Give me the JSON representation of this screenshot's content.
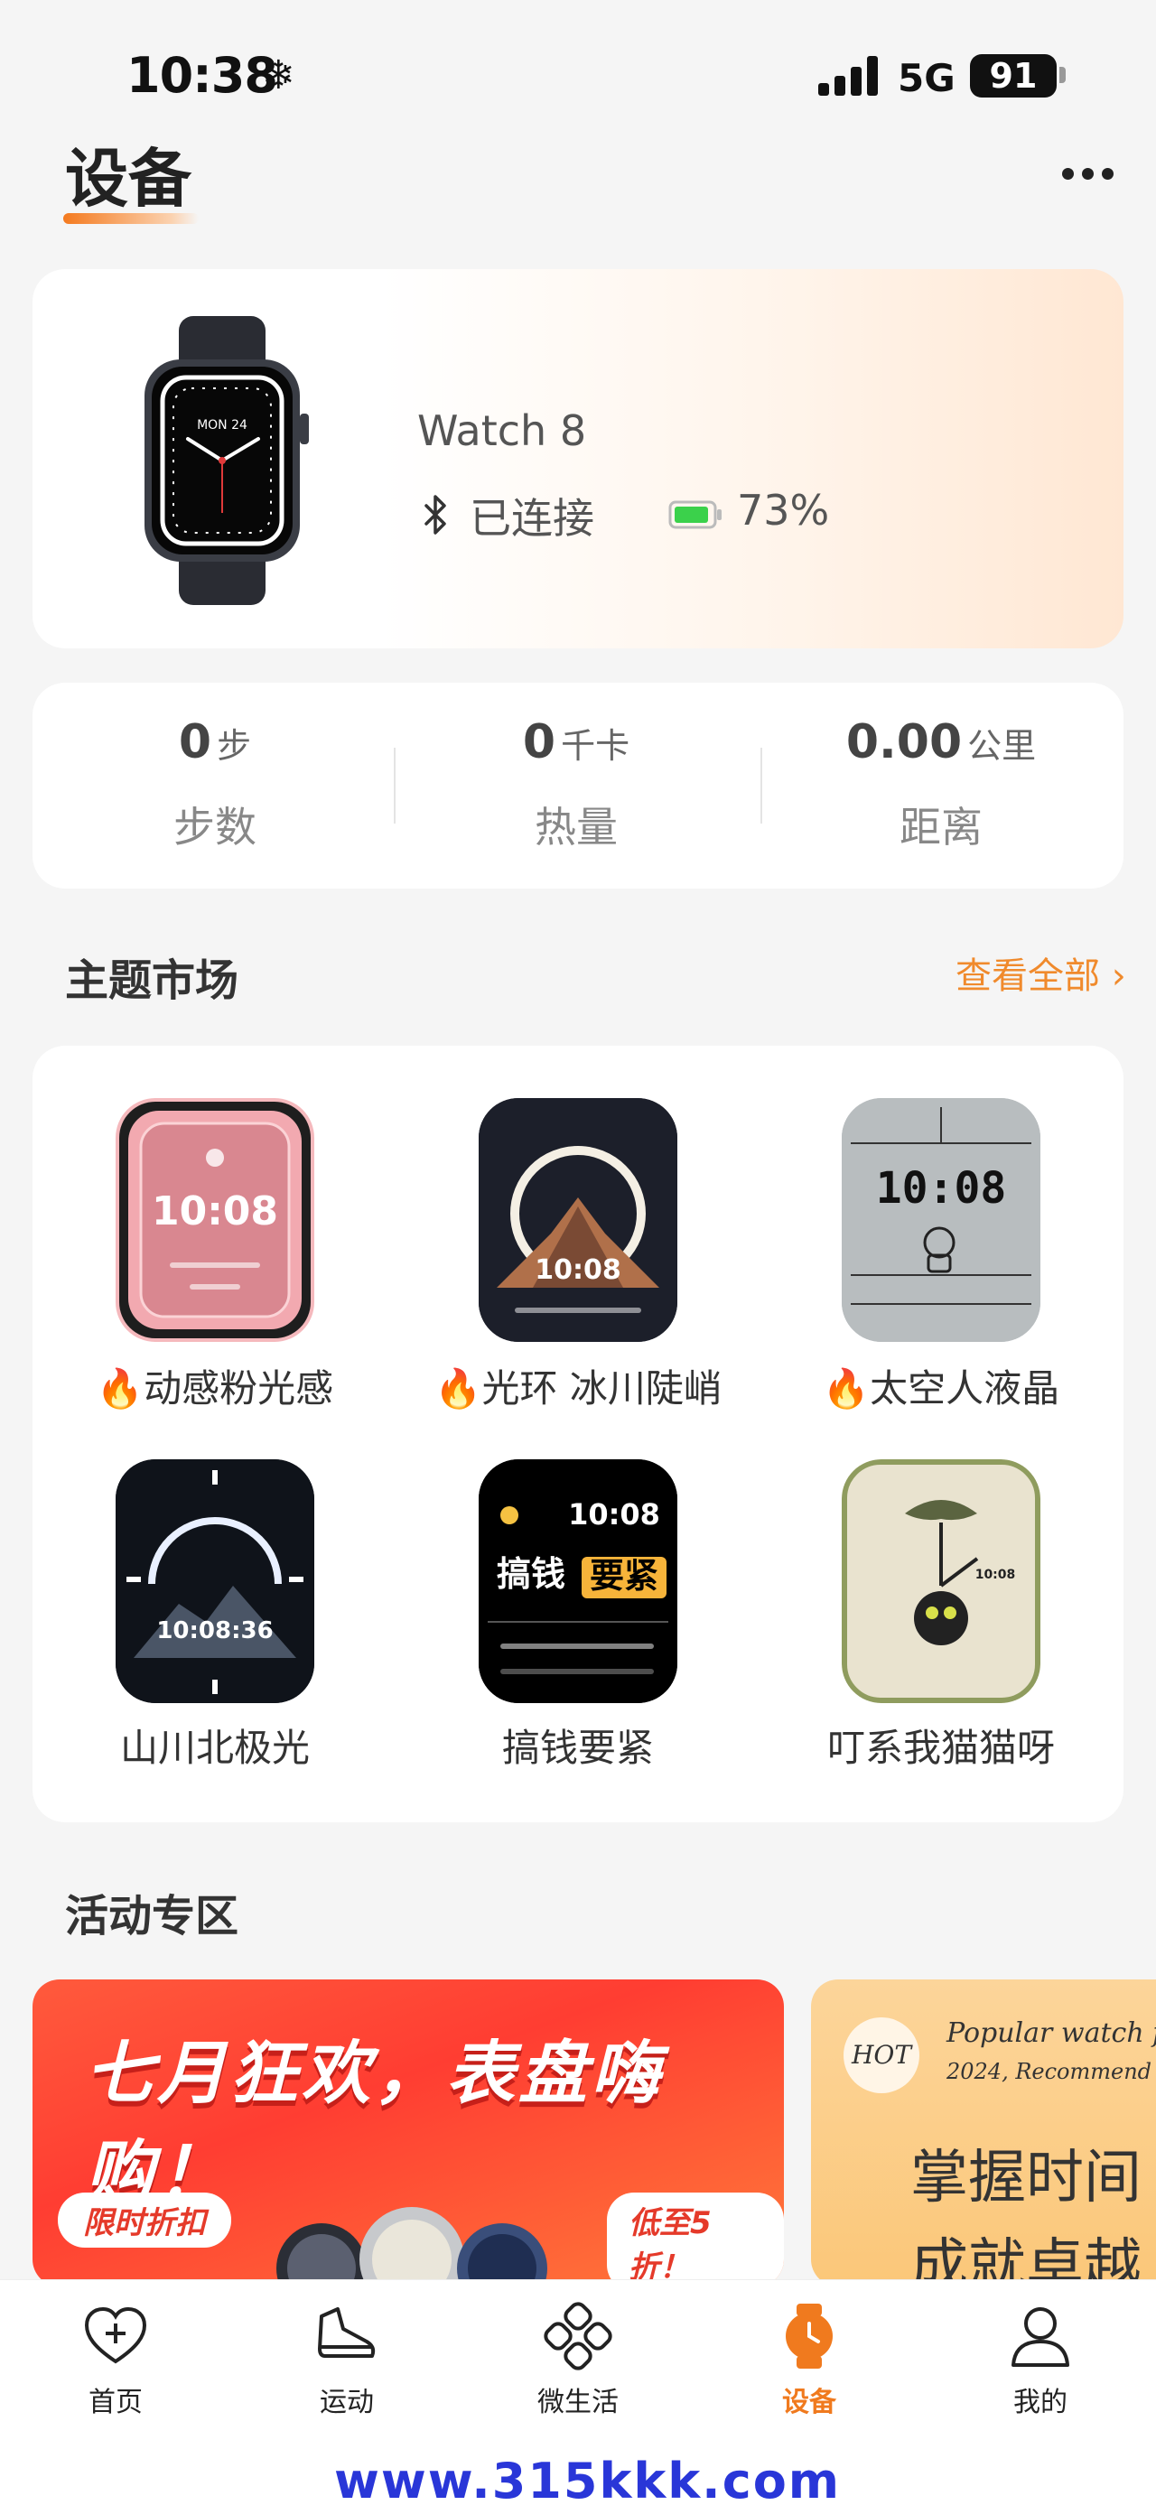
{
  "status_bar": {
    "time": "10:38",
    "network": "5G",
    "battery": "91"
  },
  "header": {
    "title": "设备"
  },
  "device": {
    "name": "Watch 8",
    "connection": "已连接",
    "battery": "73%",
    "watch_time_date": "MON 24"
  },
  "stats": [
    {
      "value": "0",
      "unit": "步",
      "label": "步数"
    },
    {
      "value": "0",
      "unit": "千卡",
      "label": "热量"
    },
    {
      "value": "0.00",
      "unit": "公里",
      "label": "距离"
    }
  ],
  "theme_market": {
    "title": "主题市场",
    "view_all": "查看全部 ›",
    "items": [
      {
        "label": "🔥动感粉光感",
        "face_time": "10:08"
      },
      {
        "label": "🔥光环 冰川陡峭",
        "face_time": "10:08"
      },
      {
        "label": "🔥太空人液晶",
        "face_time": "10:08"
      },
      {
        "label": "山川北极光",
        "face_time": "10:08:36"
      },
      {
        "label": "搞钱要紧",
        "face_time": "10:08",
        "face_text_1": "搞钱",
        "face_text_2": "要紧"
      },
      {
        "label": "叮系我猫猫呀",
        "face_time": "10:08"
      }
    ]
  },
  "activity": {
    "title": "活动专区",
    "banner1": {
      "title": "七月狂欢，表盘嗨购！",
      "tag_left": "限时折扣",
      "tag_right": "低至5折！"
    },
    "banner2": {
      "badge": "HOT",
      "en": "Popular watch f",
      "year": "2024, Recommend",
      "cn1": "掌握时间",
      "cn2": "成就卓越"
    }
  },
  "tabs": [
    {
      "label": "首页",
      "icon": "heart-plus-icon"
    },
    {
      "label": "运动",
      "icon": "shoe-icon"
    },
    {
      "label": "微生活",
      "icon": "clover-icon"
    },
    {
      "label": "设备",
      "icon": "watch-icon",
      "active": true
    },
    {
      "label": "我的",
      "icon": "user-icon"
    }
  ],
  "watermark": "www.315kkk.com",
  "colors": {
    "accent": "#f07a1e",
    "background": "#f5f5f5"
  }
}
